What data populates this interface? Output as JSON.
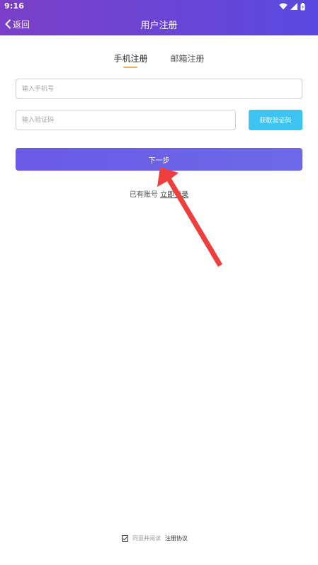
{
  "status_bar": {
    "time": "9:16"
  },
  "header": {
    "back_label": "返回",
    "title": "用户注册"
  },
  "tabs": [
    {
      "label": "手机注册",
      "active": true
    },
    {
      "label": "邮箱注册",
      "active": false
    }
  ],
  "form": {
    "phone_placeholder": "输入手机号",
    "phone_value": "",
    "code_placeholder": "输入验证码",
    "code_value": "",
    "get_code_label": "获取验证码",
    "next_label": "下一步"
  },
  "login": {
    "prompt": "已有账号",
    "link": "立即登录"
  },
  "agreement": {
    "checked": true,
    "text": "同意并阅读",
    "link": "注册协议"
  },
  "colors": {
    "header_start": "#7b3fc8",
    "header_end": "#5a49e0",
    "primary": "#6a5ae6",
    "sms_button": "#3dc4f3",
    "tab_underline": "#f0b06a",
    "annotation_arrow": "#ef3e3e"
  }
}
